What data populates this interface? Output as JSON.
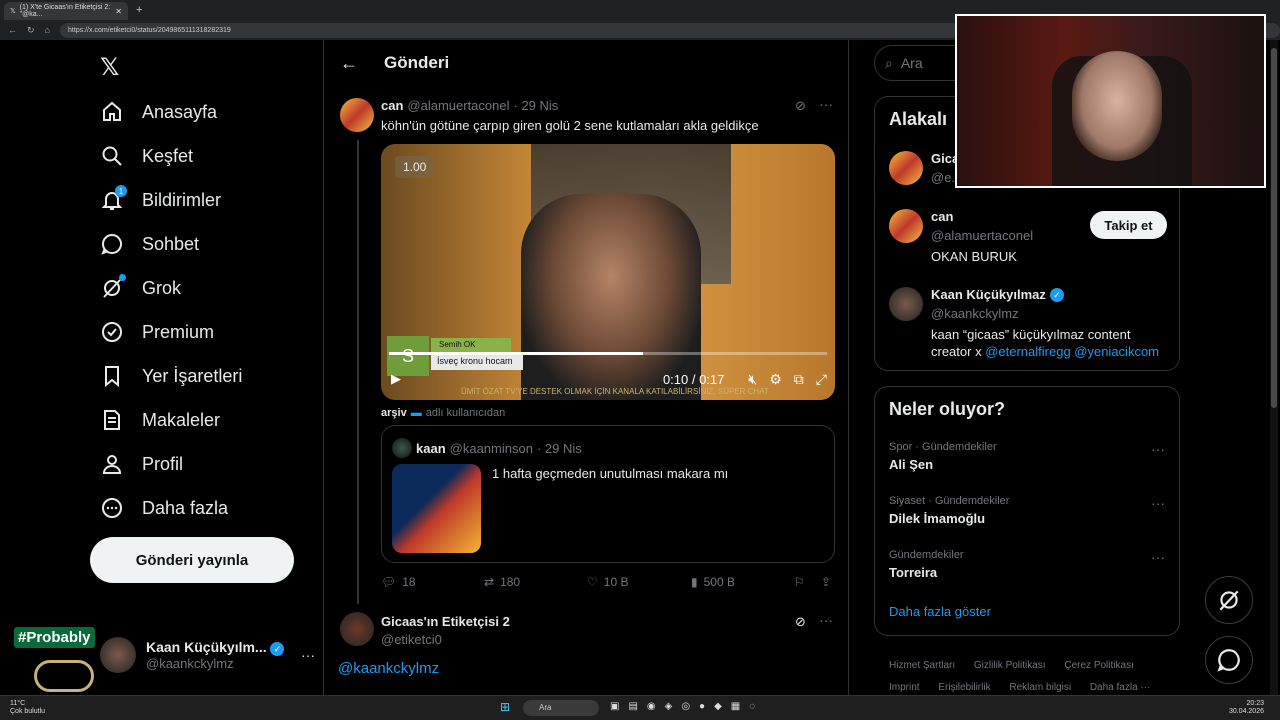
{
  "browser": {
    "tab_title": "(1) X'te Gicaas'ın Etiketçisi 2: \"@ka...",
    "url": "https://x.com/etiketci0/status/2049865111318282319"
  },
  "nav": {
    "items": [
      {
        "label": "Anasayfa",
        "icon": "home-icon"
      },
      {
        "label": "Keşfet",
        "icon": "search-icon"
      },
      {
        "label": "Bildirimler",
        "icon": "bell-icon",
        "badge": "1"
      },
      {
        "label": "Sohbet",
        "icon": "chat-icon"
      },
      {
        "label": "Grok",
        "icon": "grok-icon"
      },
      {
        "label": "Premium",
        "icon": "verified-icon"
      },
      {
        "label": "Yer İşaretleri",
        "icon": "bookmark-icon"
      },
      {
        "label": "Makaleler",
        "icon": "article-icon"
      },
      {
        "label": "Profil",
        "icon": "person-icon"
      },
      {
        "label": "Daha fazla",
        "icon": "more-icon"
      }
    ],
    "post_button": "Gönderi yayınla",
    "profile_name": "Kaan Küçükyılm...",
    "profile_handle": "@kaankckylmz",
    "probably": "#Probably"
  },
  "main": {
    "header_title": "Gönderi",
    "tweet": {
      "name": "can",
      "handle": "@alamuertaconel",
      "date": "· 29 Nis",
      "text": "köhn'ün götüne çarpıp giren golü 2 sene kutlamaları akla geldikçe",
      "video": {
        "speed": "1.00",
        "time": "0:10 / 0:17",
        "progress": 0.58,
        "lower_third_name": "Semih OK",
        "lower_third_title": "İsveç kronu hocam",
        "lower_third_letter": "S",
        "banner": "ÜMİT ÖZAT TV'YE DESTEK OLMAK İÇİN KANALA KATILABİLİRSİNİZ, SÜPER CHAT"
      },
      "via_name": "arşiv",
      "via_suffix": "adlı kullanıcıdan",
      "quote": {
        "name": "kaan",
        "handle": "@kaanminson",
        "date": "· 29 Nis",
        "text": "1 hafta geçmeden unutulması makara mı"
      },
      "stats": {
        "replies": "18",
        "retweets": "180",
        "likes": "10 B",
        "views": "500 B"
      }
    },
    "reply": {
      "name": "Gicaas'ın Etiketçisi 2",
      "handle": "@etiketci0",
      "mention": "@kaankckylmz"
    }
  },
  "sidebar": {
    "search_placeholder": "Ara",
    "related_title": "Alakalı",
    "related": [
      {
        "name": "Gica",
        "handle": "@e..."
      },
      {
        "name": "can",
        "handle": "@alamuertaconel",
        "bio": "OKAN BURUK",
        "follow": "Takip et"
      },
      {
        "name": "Kaan Küçükyılmaz",
        "handle": "@kaankckylmz",
        "bio": "kaan “gicaas” küçükyılmaz content creator x",
        "bio_links": "@eternalfiregg @yeniacikcom"
      }
    ],
    "trends_title": "Neler oluyor?",
    "trends": [
      {
        "category": "Spor · Gündemdekiler",
        "title": "Ali Şen"
      },
      {
        "category": "Siyaset · Gündemdekiler",
        "title": "Dilek İmamoğlu"
      },
      {
        "category": "Gündemdekiler",
        "title": "Torreira"
      }
    ],
    "show_more": "Daha fazla göster",
    "footer": [
      "Hizmet Şartları",
      "Gizlilik Politikası",
      "Çerez Politikası",
      "Imprint",
      "Erişilebilirlik",
      "Reklam bilgisi",
      "Daha fazla ···"
    ]
  },
  "taskbar": {
    "search": "Ara",
    "time": "20:23",
    "date": "30.04.2026",
    "weather_temp": "11°C",
    "weather_desc": "Çok bulutlu"
  }
}
